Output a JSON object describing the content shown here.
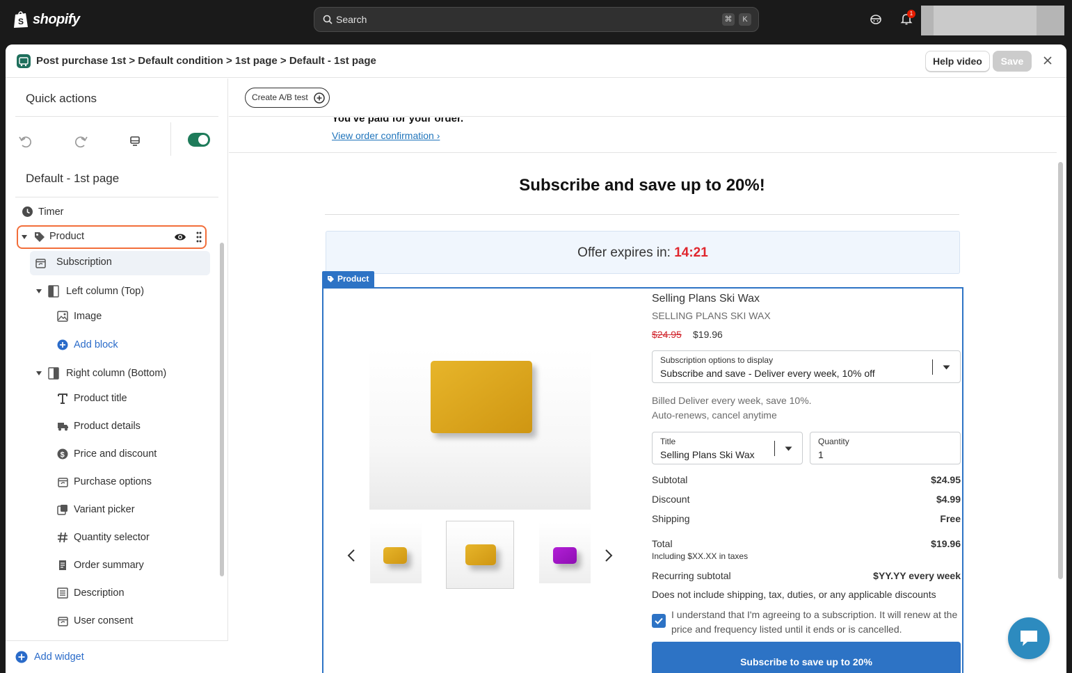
{
  "topbar": {
    "brand": "shopify",
    "search_placeholder": "Search",
    "kbd_cmd": "⌘",
    "kbd_k": "K",
    "notification_count": "1"
  },
  "header": {
    "breadcrumb": "Post purchase 1st > Default condition > 1st page > Default - 1st page",
    "help_label": "Help video",
    "save_label": "Save"
  },
  "sidebar": {
    "quick_actions_title": "Quick actions",
    "page_title": "Default - 1st page",
    "items": {
      "timer": "Timer",
      "product": "Product",
      "subscription": "Subscription",
      "left_column": "Left column (Top)",
      "image": "Image",
      "add_block": "Add block",
      "right_column": "Right column (Bottom)",
      "product_title": "Product title",
      "product_details": "Product details",
      "price_discount": "Price and discount",
      "purchase_options": "Purchase options",
      "variant_picker": "Variant picker",
      "quantity_selector": "Quantity selector",
      "order_summary": "Order summary",
      "description": "Description",
      "user_consent": "User consent"
    },
    "add_widget": "Add widget"
  },
  "canvas": {
    "ab_test_label": "Create A/B test"
  },
  "preview": {
    "paid_text": "You've paid for your order.",
    "order_link": "View order confirmation ›",
    "headline": "Subscribe and save up to 20%!",
    "timer_label": "Offer expires in: ",
    "timer_value": "14:21",
    "product_tag": "Product",
    "product": {
      "title": "Selling Plans Ski Wax",
      "subtitle": "SELLING PLANS SKI WAX",
      "old_price": "$24.95",
      "new_price": "$19.96"
    },
    "subscription_select": {
      "label": "Subscription options to display",
      "value": "Subscribe and save - Deliver every week, 10% off"
    },
    "billed_line1": "Billed Deliver every week, save 10%.",
    "billed_line2": "Auto-renews, cancel anytime",
    "title_select": {
      "label": "Title",
      "value": "Selling Plans Ski Wax"
    },
    "quantity": {
      "label": "Quantity",
      "value": "1"
    },
    "summary": {
      "subtotal_label": "Subtotal",
      "subtotal_value": "$24.95",
      "discount_label": "Discount",
      "discount_value": "$4.99",
      "shipping_label": "Shipping",
      "shipping_value": "Free",
      "total_label": "Total",
      "total_value": "$19.96",
      "taxes_note": "Including $XX.XX in taxes",
      "recurring_label": "Recurring subtotal",
      "recurring_value": "$YY.YY every week"
    },
    "disclaimer": "Does not include shipping, tax, duties, or any applicable discounts",
    "consent_text": "I understand that I'm agreeing to a subscription. It will renew at the price and frequency listed until it ends or is cancelled.",
    "cta_label": "Subscribe to save up to 20%"
  },
  "colors": {
    "accent_blue": "#2d73c5",
    "selection_orange": "#f26e3a",
    "toggle_green": "#1e7b5a",
    "timer_red": "#e0262d"
  }
}
